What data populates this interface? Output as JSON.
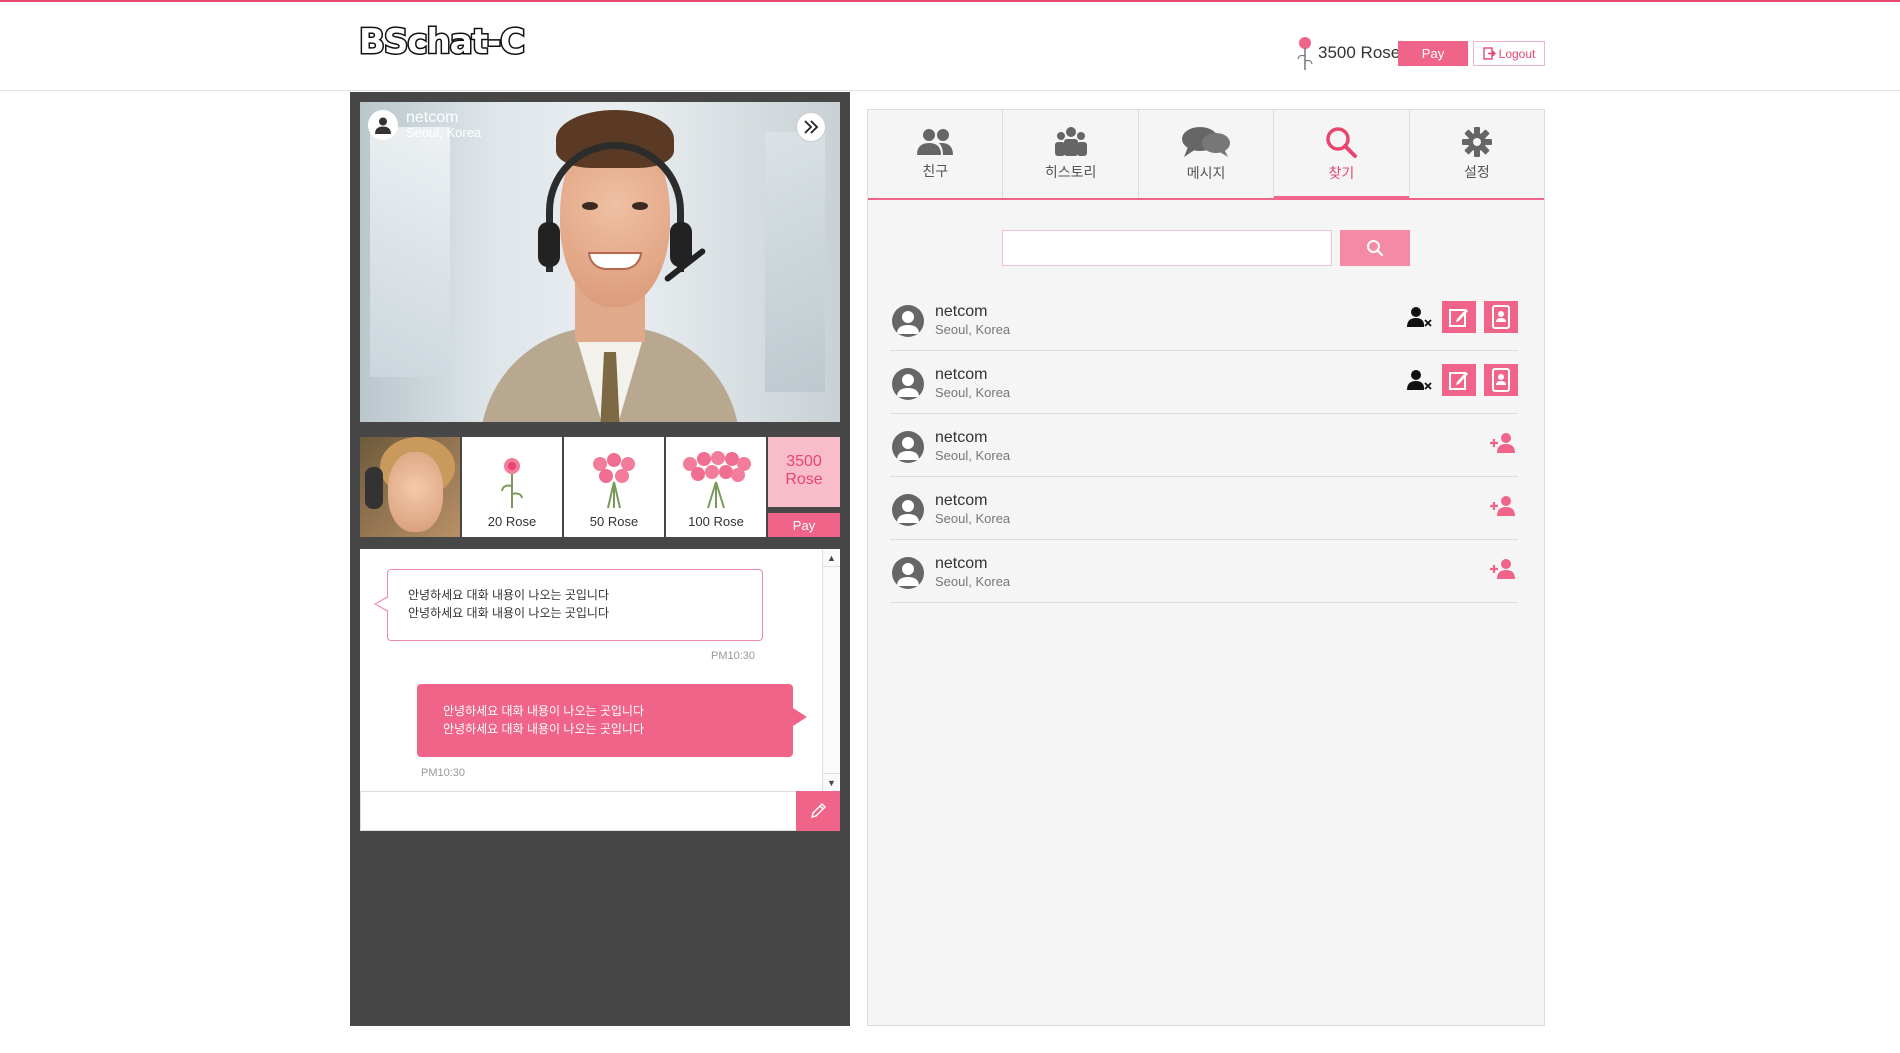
{
  "header": {
    "logo": "BSchat-C",
    "rose_count": "3500 Rose",
    "pay_label": "Pay",
    "logout_label": "Logout"
  },
  "video": {
    "user_name": "netcom",
    "user_location": "Seoul, Korea"
  },
  "gifts": [
    {
      "label": "20 Rose",
      "icon": "rose-single-icon"
    },
    {
      "label": "50 Rose",
      "icon": "rose-bouquet-icon"
    },
    {
      "label": "100 Rose",
      "icon": "rose-large-bouquet-icon"
    }
  ],
  "balance": {
    "amount": "3500",
    "unit": "Rose",
    "pay_label": "Pay"
  },
  "chat": {
    "messages": [
      {
        "direction": "in",
        "lines": [
          "안녕하세요 대화 내용이 나오는 곳입니다",
          "안녕하세요 대화 내용이 나오는 곳입니다"
        ],
        "time": "PM10:30"
      },
      {
        "direction": "out",
        "lines": [
          "안녕하세요 대화 내용이 나오는 곳입니다",
          "안녕하세요 대화 내용이 나오는 곳입니다"
        ],
        "time": "PM10:30"
      }
    ],
    "input_value": ""
  },
  "tabs": [
    {
      "label": "친구",
      "icon": "friends-icon",
      "active": false
    },
    {
      "label": "히스토리",
      "icon": "group-icon",
      "active": false
    },
    {
      "label": "메시지",
      "icon": "chat-bubbles-icon",
      "active": false
    },
    {
      "label": "찾기",
      "icon": "search-icon",
      "active": true
    },
    {
      "label": "설정",
      "icon": "gear-icon",
      "active": false
    }
  ],
  "search": {
    "value": ""
  },
  "friends": [
    {
      "name": "netcom",
      "location": "Seoul, Korea",
      "type": "friend"
    },
    {
      "name": "netcom",
      "location": "Seoul, Korea",
      "type": "friend"
    },
    {
      "name": "netcom",
      "location": "Seoul, Korea",
      "type": "add"
    },
    {
      "name": "netcom",
      "location": "Seoul, Korea",
      "type": "add"
    },
    {
      "name": "netcom",
      "location": "Seoul, Korea",
      "type": "add"
    }
  ],
  "colors": {
    "accent": "#f0648a",
    "accent_dark": "#e8456f",
    "accent_light": "#f9bccb",
    "panel_dark": "#474747"
  }
}
